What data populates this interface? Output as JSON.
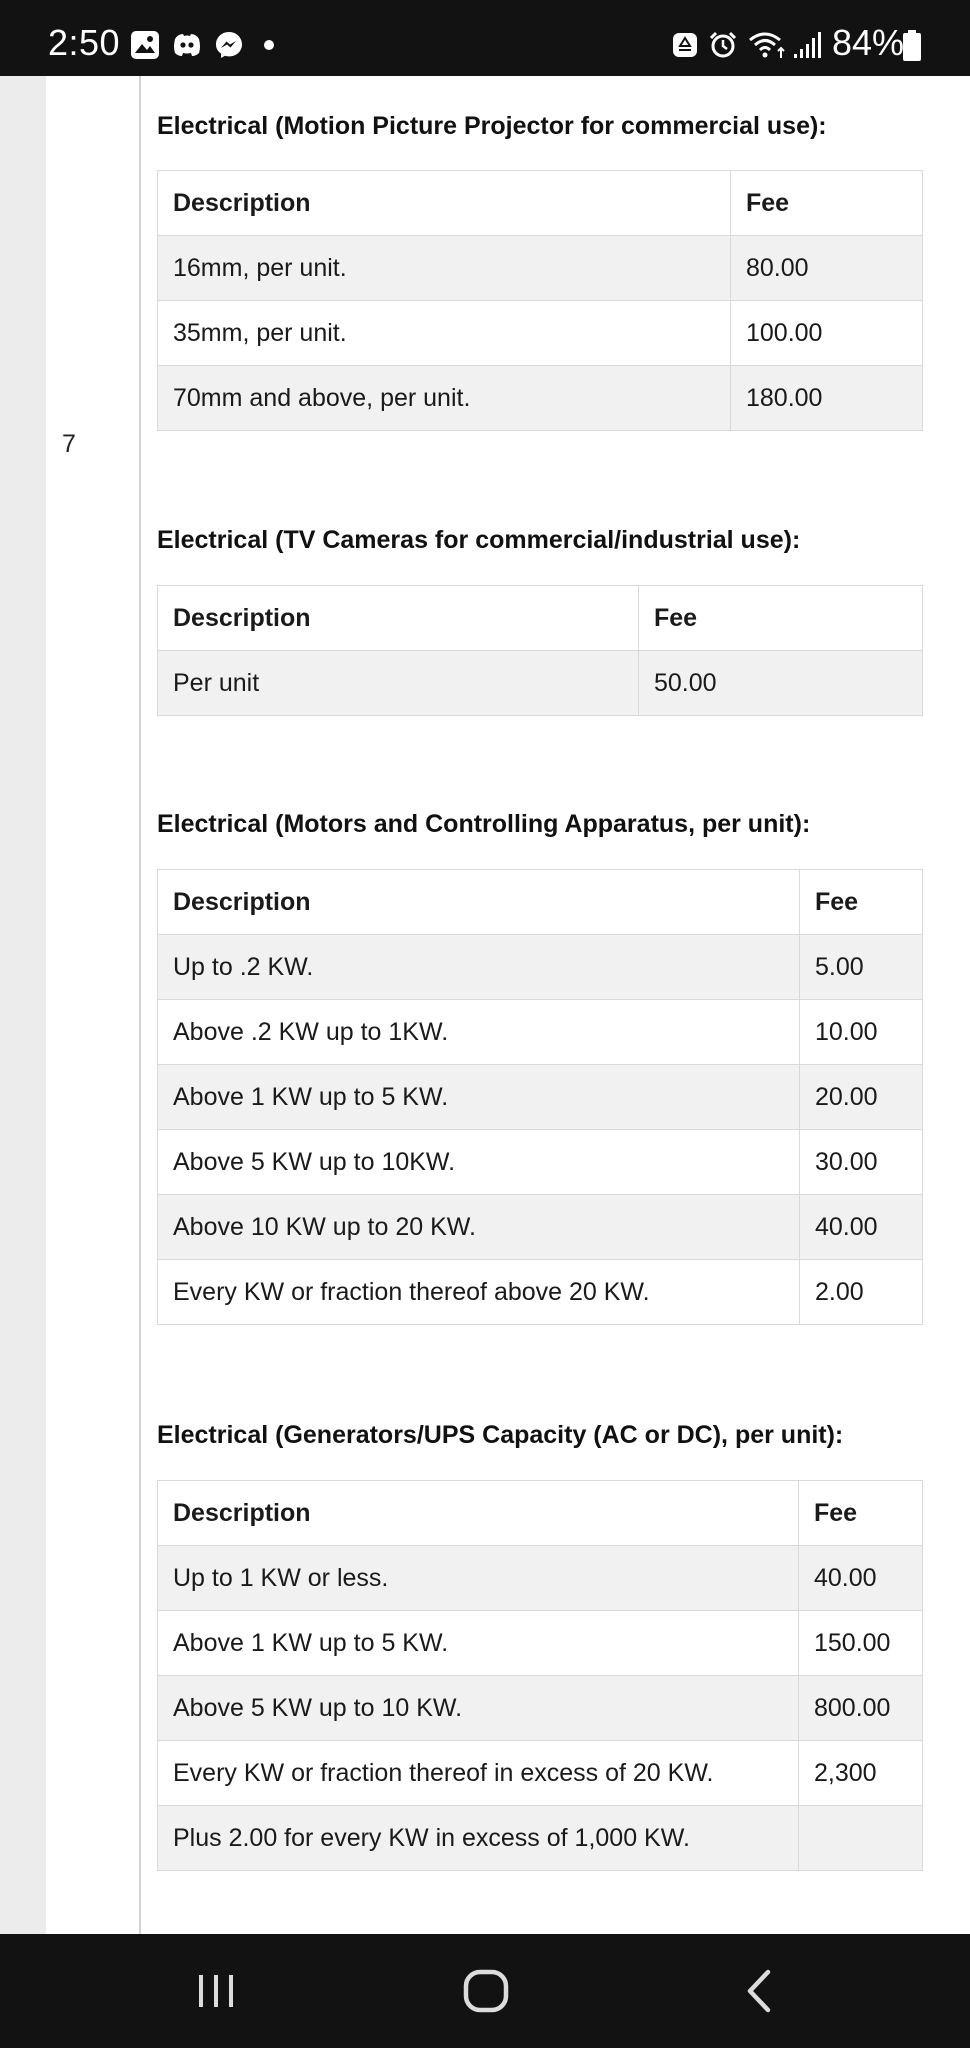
{
  "status_bar": {
    "time": "2:50",
    "left_icons": [
      "gallery-icon",
      "discord-icon",
      "messenger-icon"
    ],
    "right_icons": [
      "recycle-icon",
      "alarm-icon",
      "wifi-icon",
      "signal-icon",
      "battery-icon"
    ],
    "battery_percent": "84%"
  },
  "row_number": "7",
  "sections": [
    {
      "heading": "Electrical (Motion Picture Projector for commercial use):",
      "columns": [
        "Description",
        "Fee"
      ],
      "rows": [
        [
          "16mm, per unit.",
          "80.00"
        ],
        [
          "35mm, per unit.",
          "100.00"
        ],
        [
          "70mm and above, per unit.",
          "180.00"
        ]
      ]
    },
    {
      "heading": "Electrical (TV Cameras for commercial/industrial use):",
      "columns": [
        "Description",
        "Fee"
      ],
      "rows": [
        [
          "Per unit",
          "50.00"
        ]
      ]
    },
    {
      "heading": "Electrical (Motors and Controlling Apparatus, per unit):",
      "columns": [
        "Description",
        "Fee"
      ],
      "rows": [
        [
          "Up to .2 KW.",
          "5.00"
        ],
        [
          "Above .2 KW up to 1KW.",
          "10.00"
        ],
        [
          "Above 1 KW up to 5 KW.",
          "20.00"
        ],
        [
          "Above 5 KW up to 10KW.",
          "30.00"
        ],
        [
          "Above 10 KW up to 20 KW.",
          "40.00"
        ],
        [
          "Every KW or fraction thereof above 20 KW.",
          "2.00"
        ]
      ]
    },
    {
      "heading": "Electrical (Generators/UPS Capacity (AC or DC), per unit):",
      "columns": [
        "Description",
        "Fee"
      ],
      "rows": [
        [
          "Up to 1 KW or less.",
          "40.00"
        ],
        [
          "Above 1 KW up to 5 KW.",
          "150.00"
        ],
        [
          "Above 5 KW up to 10 KW.",
          "800.00"
        ],
        [
          "Every KW or fraction thereof in excess of 20 KW.",
          "2,300"
        ],
        [
          "Plus 2.00 for every KW in excess of 1,000 KW.",
          ""
        ]
      ]
    }
  ],
  "nav_bar": {
    "buttons": [
      "recent-apps-icon",
      "home-icon",
      "back-icon"
    ]
  }
}
